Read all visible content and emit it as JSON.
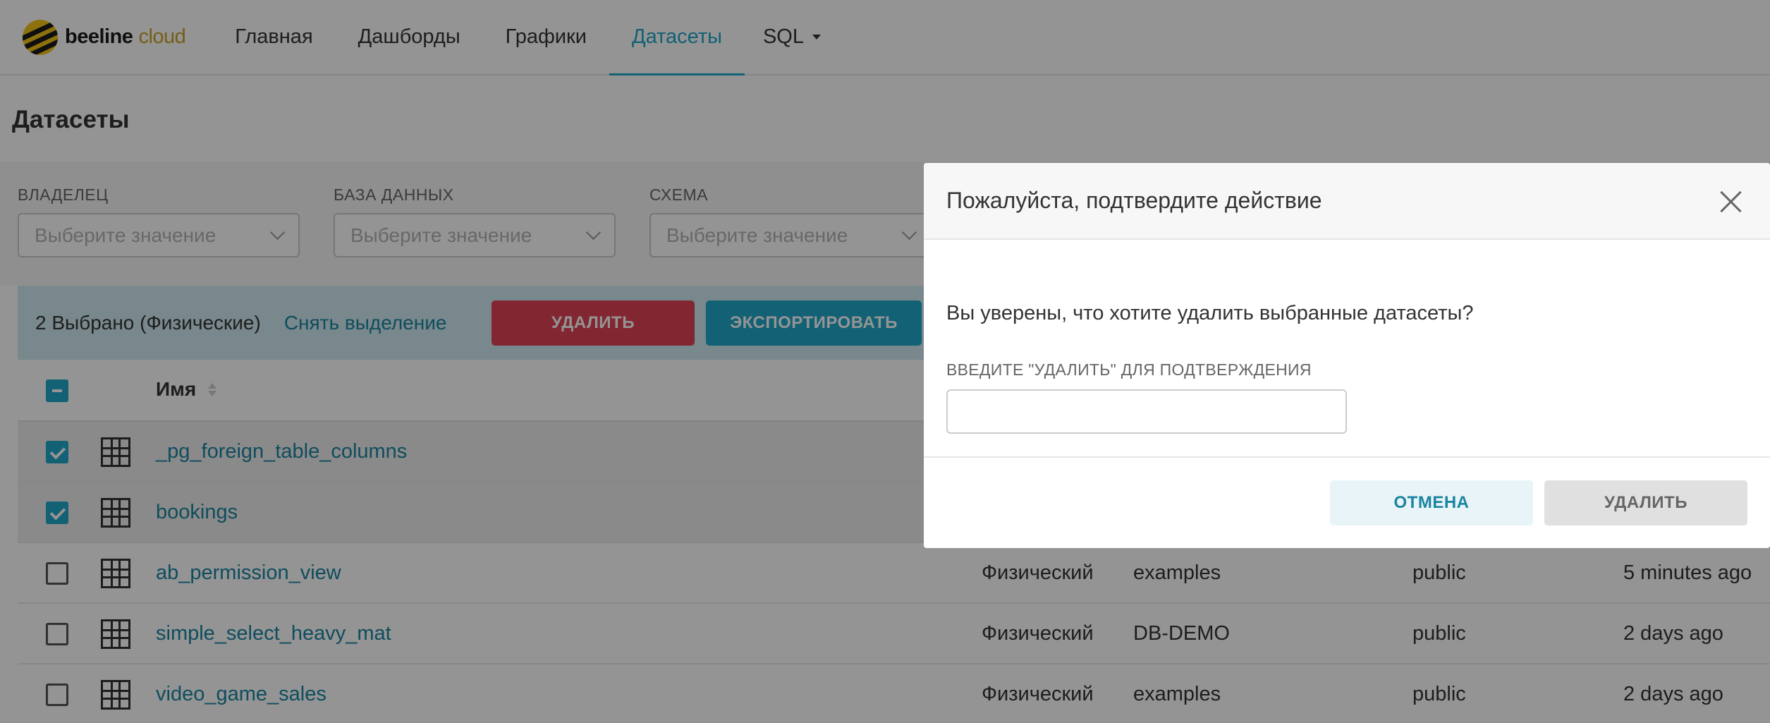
{
  "brand": {
    "name_bold": "beeline",
    "name_light": "cloud"
  },
  "nav": {
    "items": [
      {
        "label": "Главная"
      },
      {
        "label": "Дашборды"
      },
      {
        "label": "Графики"
      },
      {
        "label": "Датасеты",
        "active": true
      },
      {
        "label": "SQL"
      }
    ]
  },
  "page": {
    "title": "Датасеты"
  },
  "filters": [
    {
      "label": "ВЛАДЕЛЕЦ",
      "placeholder": "Выберите значение"
    },
    {
      "label": "БАЗА ДАННЫХ",
      "placeholder": "Выберите значение"
    },
    {
      "label": "СХЕМА",
      "placeholder": "Выберите значение"
    }
  ],
  "bulk": {
    "count_text": "2 Выбрано (Физические)",
    "deselect": "Снять выделение",
    "delete": "УДАЛИТЬ",
    "export": "ЭКСПОРТИРОВАТЬ"
  },
  "table": {
    "header_name": "Имя",
    "rows": [
      {
        "name": "_pg_foreign_table_columns",
        "selected": true,
        "kind": "",
        "db": "",
        "schema": "",
        "modified": ""
      },
      {
        "name": "bookings",
        "selected": true,
        "kind": "",
        "db": "",
        "schema": "",
        "modified": ""
      },
      {
        "name": "ab_permission_view",
        "selected": false,
        "kind": "Физический",
        "db": "examples",
        "schema": "public",
        "modified": "5 minutes ago"
      },
      {
        "name": "simple_select_heavy_mat",
        "selected": false,
        "kind": "Физический",
        "db": "DB-DEMO",
        "schema": "public",
        "modified": "2 days ago"
      },
      {
        "name": "video_game_sales",
        "selected": false,
        "kind": "Физический",
        "db": "examples",
        "schema": "public",
        "modified": "2 days ago"
      }
    ]
  },
  "modal": {
    "title": "Пожалуйста, подтвердите действие",
    "question": "Вы уверены, что хотите удалить выбранные датасеты?",
    "confirm_label": "ВВЕДИТЕ \"УДАЛИТЬ\" ДЛЯ ПОДТВЕРЖДЕНИЯ",
    "confirm_value": "",
    "cancel": "ОТМЕНА",
    "delete": "УДАЛИТЬ"
  },
  "colors": {
    "accent": "#20a7c9",
    "danger": "#e04355",
    "brand_yellow": "#f2c318"
  },
  "icons": [
    "beeline-logo-icon",
    "chevron-down-icon",
    "sort-icon",
    "table-grid-icon",
    "close-icon",
    "caret-down-icon"
  ]
}
